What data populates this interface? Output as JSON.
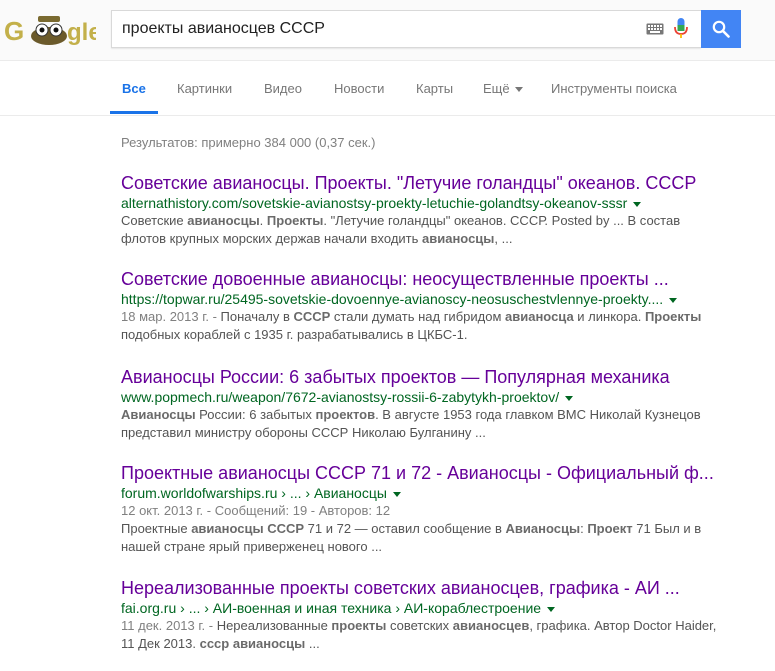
{
  "search": {
    "query": "проекты авианосцев СССР"
  },
  "tabs": [
    {
      "label": "Все"
    },
    {
      "label": "Картинки"
    },
    {
      "label": "Видео"
    },
    {
      "label": "Новости"
    },
    {
      "label": "Карты"
    },
    {
      "label": "Ещё"
    },
    {
      "label": "Инструменты поиска"
    }
  ],
  "stats": "Результатов: примерно 384 000 (0,37 сек.)",
  "results": [
    {
      "title": "Советские авианосцы. Проекты. \"Летучие голандцы\" океанов. СССР",
      "url": "alternathistory.com/sovetskie-avianostsy-proekty-letuchie-golandtsy-okeanov-sssr",
      "snippet": [
        [
          "Советские ",
          "авианосцы",
          ". ",
          "Проекты",
          ". \"Летучие голандцы\" океанов. СССР. Posted by ... В состав"
        ],
        [
          "флотов крупных морских держав начали входить ",
          "авианосцы",
          ", ..."
        ]
      ]
    },
    {
      "title": "Советские довоенные авианосцы: неосуществленные проекты ...",
      "url": "https://topwar.ru/25495-sovetskie-dovoennye-avianoscy-neosuschestvlennye-proekty....",
      "date": "18 мар. 2013 г. - ",
      "snippet": [
        [
          "Поначалу в ",
          "СССР",
          " стали думать над гибридом ",
          "авианосца",
          " и линкора. ",
          "Проекты"
        ],
        [
          "подобных кораблей с 1935 г. разрабатывались в ЦКБС-1."
        ]
      ]
    },
    {
      "title": "Авианосцы России: 6 забытых проектов — Популярная механика",
      "url": "www.popmech.ru/weapon/7672-avianostsy-rossii-6-zabytykh-proektov/",
      "snippet": [
        [
          "",
          "Авианосцы",
          " России: 6 забытых ",
          "проектов",
          ". В августе 1953 года главком ВМС Николай Кузнецов"
        ],
        [
          "представил министру обороны СССР Николаю Булганину ..."
        ]
      ]
    },
    {
      "title": "Проектные авианосцы СССР 71 и 72 - Авианосцы - Официальный ф...",
      "url": "forum.worldofwarships.ru › ... › Авианосцы",
      "meta": "12 окт. 2013 г. - Сообщений: 19 - Авторов: 12",
      "snippet": [
        [
          "Проектные ",
          "авианосцы СССР",
          " 71 и 72 — оставил сообщение в ",
          "Авианосцы",
          ": ",
          "Проект",
          " 71 Был и в"
        ],
        [
          "нашей стране ярый приверженец нового ..."
        ]
      ]
    },
    {
      "title": "Нереализованные проекты советских авианосцев, графика - АИ ...",
      "url": "fai.org.ru › ... › АИ-военная и иная техника › АИ-кораблестроение",
      "date": "11 дек. 2013 г. - ",
      "snippet": [
        [
          "Нереализованные ",
          "проекты",
          " советских ",
          "авианосцев",
          ", графика. Автор Doctor Haider,"
        ],
        [
          "11 Дек 2013. ",
          "ссср авианосцы",
          " ..."
        ]
      ]
    }
  ],
  "colors": {
    "accent": "#1a73e8",
    "search_button": "#4285f4",
    "title_visited": "#660099",
    "url": "#006621"
  }
}
